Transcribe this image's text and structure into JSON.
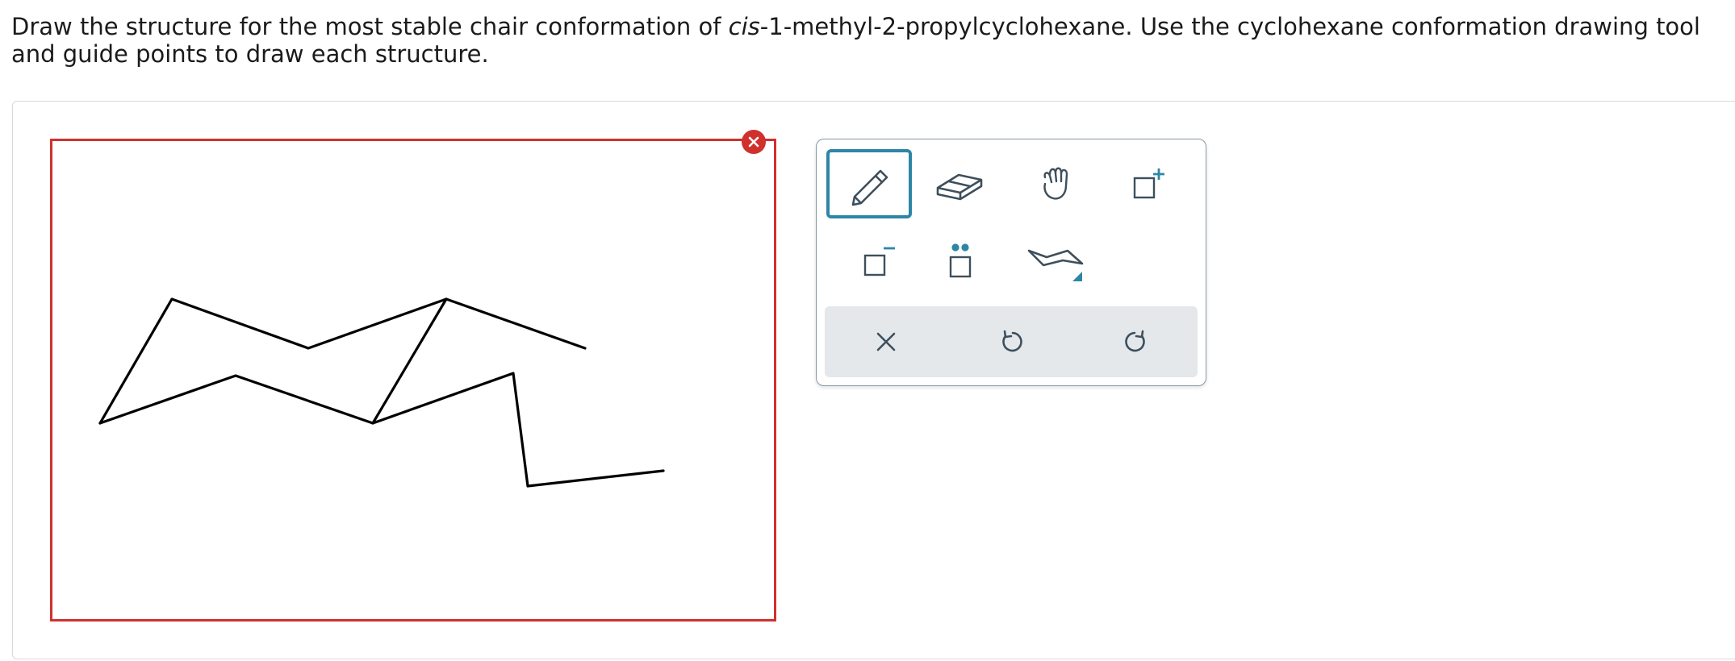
{
  "prompt": {
    "before": "Draw the structure for the most stable chair conformation of ",
    "italic": "cis",
    "after": "-1-methyl-2-propylcyclohexane. Use the cyclohexane conformation drawing tool and guide points to draw each structure."
  },
  "colors": {
    "canvas_border": "#d0312d",
    "accent": "#2d86a6",
    "icon": "#3d4f5c",
    "actionbar": "#e4e8eb",
    "stroke": "#000000"
  },
  "toolbar": {
    "tools": [
      {
        "name": "pencil",
        "icon": "pencil-icon",
        "selected": true
      },
      {
        "name": "eraser",
        "icon": "eraser-icon",
        "selected": false
      },
      {
        "name": "move",
        "icon": "hand-icon",
        "selected": false
      },
      {
        "name": "positive-charge",
        "icon": "charge-plus-icon",
        "selected": false
      },
      {
        "name": "negative-charge",
        "icon": "charge-minus-icon",
        "selected": false
      },
      {
        "name": "lone-pair",
        "icon": "lone-pair-icon",
        "selected": false
      },
      {
        "name": "chair-template",
        "icon": "chair-template-icon",
        "selected": false
      }
    ],
    "actions": [
      {
        "name": "clear",
        "icon": "close-icon"
      },
      {
        "name": "undo",
        "icon": "undo-icon"
      },
      {
        "name": "redo",
        "icon": "redo-icon"
      }
    ]
  }
}
